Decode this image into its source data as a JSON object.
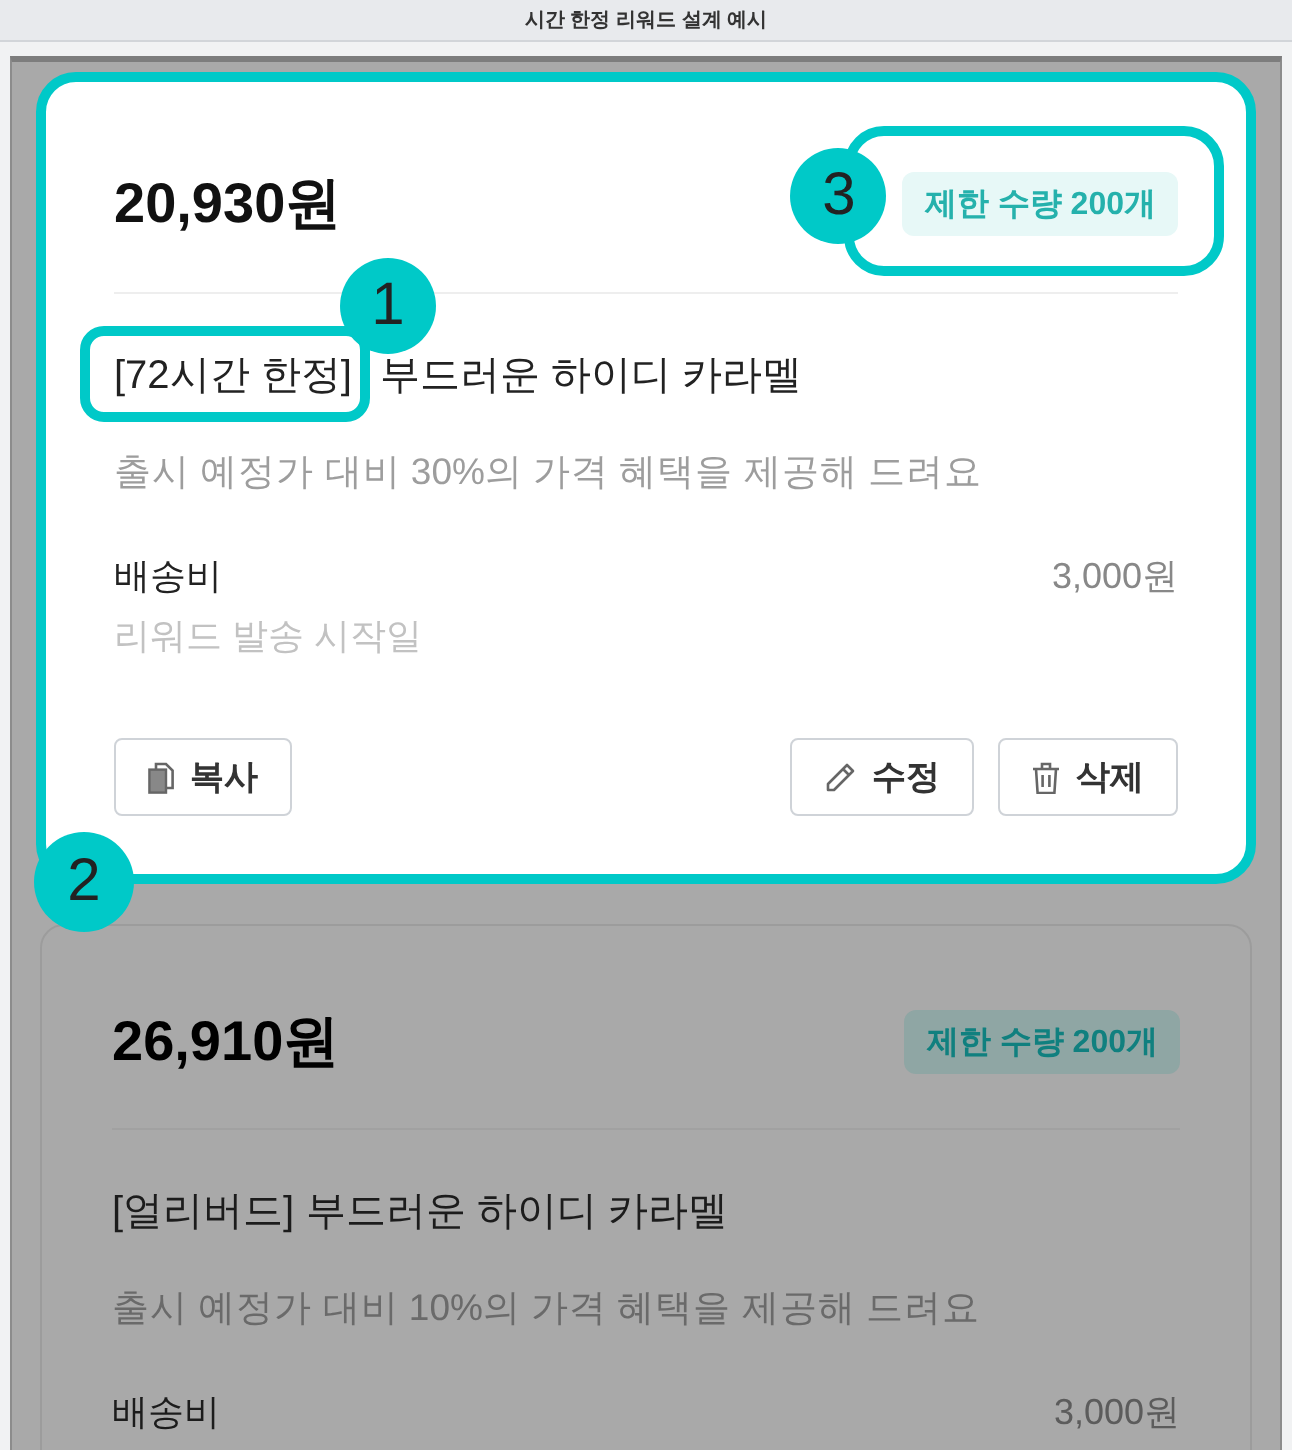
{
  "window": {
    "title": "시간 한정 리워드 설계 예시"
  },
  "rewards": [
    {
      "highlighted": true,
      "price": "20,930원",
      "badge": "제한 수량 200개",
      "badge_marker": "3",
      "tag": "[72시간 한정]",
      "tag_marker": "1",
      "name": "부드러운 하이디 카라멜",
      "description": "출시 예정가 대비 30%의 가격 혜택을 제공해 드려요",
      "shipping_label": "배송비",
      "shipping_fee": "3,000원",
      "start_date_label": "리워드 발송 시작일",
      "buttons": [
        {
          "kind": "copy",
          "label": "복사"
        },
        {
          "kind": "edit",
          "label": "수정"
        },
        {
          "kind": "delete",
          "label": "삭제"
        }
      ],
      "card_marker": "2"
    },
    {
      "highlighted": false,
      "price": "26,910원",
      "badge": "제한 수량 200개",
      "tag": "[얼리버드]",
      "name": "부드러운 하이디 카라멜",
      "description": "출시 예정가 대비 10%의 가격 혜택을 제공해 드려요",
      "shipping_label": "배송비",
      "shipping_fee": "3,000원"
    }
  ]
}
